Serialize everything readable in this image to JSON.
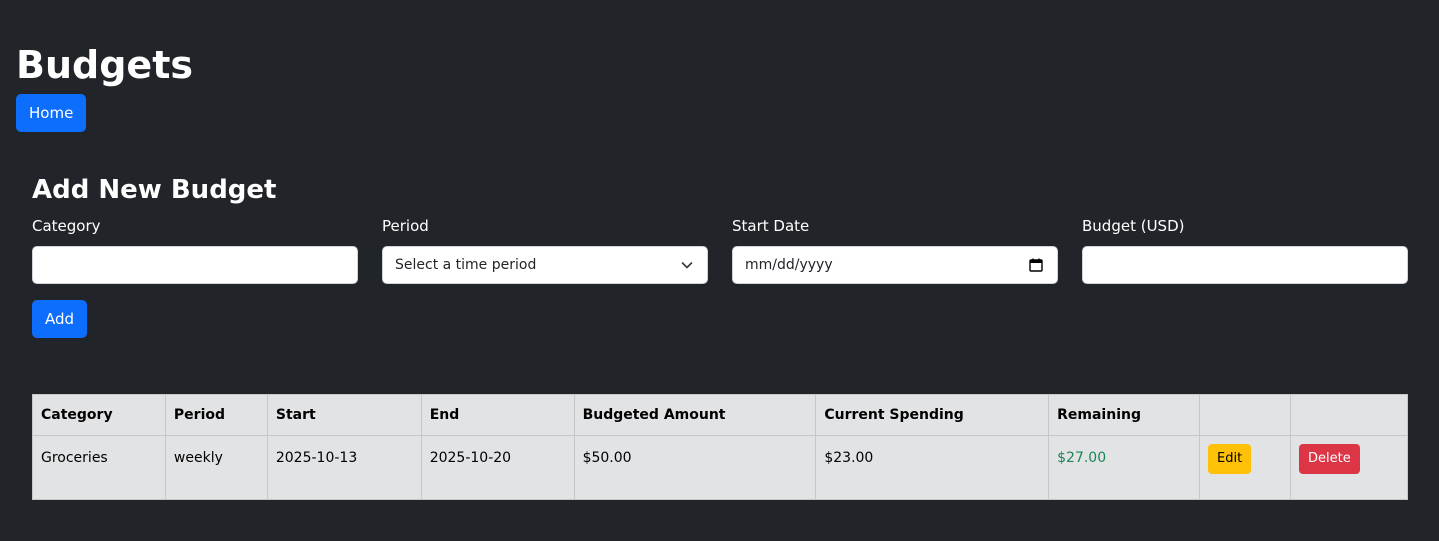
{
  "page": {
    "title": "Budgets",
    "home_button": "Home"
  },
  "form": {
    "title": "Add New Budget",
    "category": {
      "label": "Category",
      "value": ""
    },
    "period": {
      "label": "Period",
      "selected": "Select a time period"
    },
    "start_date": {
      "label": "Start Date",
      "placeholder": "mm/dd/yyyy"
    },
    "budget": {
      "label": "Budget (USD)",
      "value": ""
    },
    "add_button": "Add"
  },
  "table": {
    "headers": [
      "Category",
      "Period",
      "Start",
      "End",
      "Budgeted Amount",
      "Current Spending",
      "Remaining",
      "",
      ""
    ],
    "rows": [
      {
        "category": "Groceries",
        "period": "weekly",
        "start": "2025-10-13",
        "end": "2025-10-20",
        "budgeted": "$50.00",
        "spending": "$23.00",
        "remaining": "$27.00",
        "edit_label": "Edit",
        "delete_label": "Delete"
      }
    ]
  },
  "colors": {
    "background": "#212529",
    "primary": "#0d6efd",
    "warning": "#ffc107",
    "danger": "#dc3545",
    "success_text": "#198754",
    "table_bg": "#e2e3e5"
  },
  "icons": {
    "period_select": "chevron-down-icon",
    "start_date": "calendar-icon"
  }
}
